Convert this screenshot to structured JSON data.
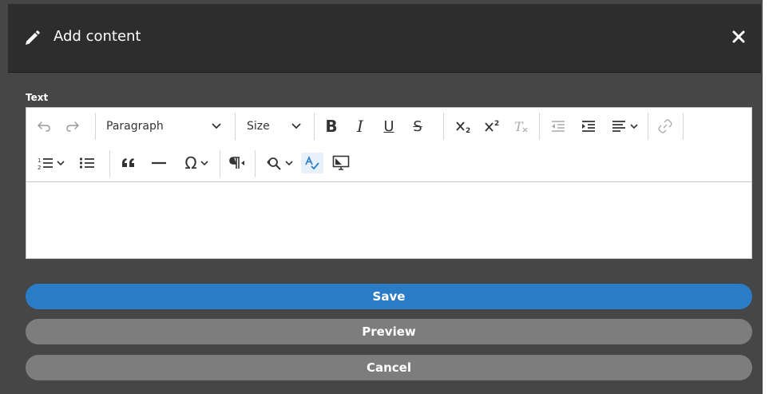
{
  "dialog": {
    "title": "Add content",
    "icon": "pencil-icon",
    "close_icon": "close-icon"
  },
  "field": {
    "label": "Text"
  },
  "toolbar": {
    "paragraph_format": "Paragraph",
    "font_size": "Size",
    "bold_label": "B",
    "italic_label": "I",
    "underline_label": "U",
    "strike_label": "S"
  },
  "buttons": {
    "save": "Save",
    "preview": "Preview",
    "cancel": "Cancel"
  },
  "colors": {
    "header_bg": "#2d2d2d",
    "body_bg": "#464646",
    "primary": "#2a7cc7",
    "secondary": "#7d7d7d",
    "active_tool": "#2a7cc7"
  }
}
